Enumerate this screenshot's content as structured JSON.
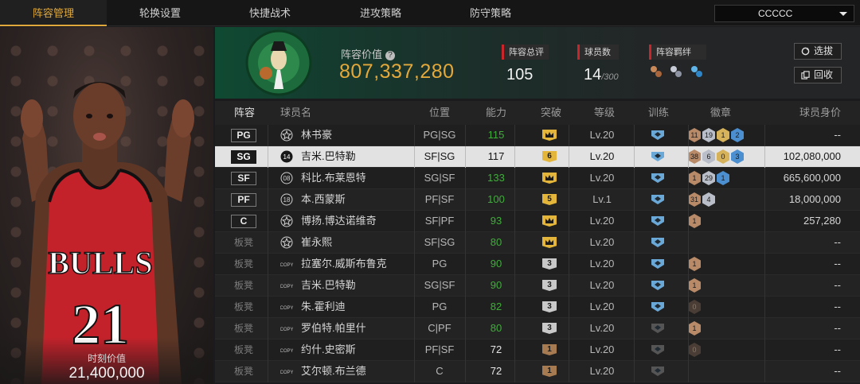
{
  "nav": {
    "tabs": [
      "阵容管理",
      "轮换设置",
      "快捷战术",
      "进攻策略",
      "防守策略"
    ],
    "active_tab": 0,
    "team_select": "CCCCC"
  },
  "featured_player": {
    "value_label": "时刻价值",
    "value": "21,400,000",
    "jersey": "21",
    "team_text": "BULLS"
  },
  "header": {
    "team_value_label": "阵容价值",
    "team_value": "807,337,280",
    "overall_label": "阵容总评",
    "overall_value": "105",
    "player_count_label": "球员数",
    "player_count": "14",
    "player_count_max": "/300",
    "bond_label": "阵容羁绊",
    "logo_text": "BOSTON CELTICS",
    "select_button": "选拔",
    "recycle_button": "回收"
  },
  "table": {
    "headers": {
      "lineup": "阵容",
      "name": "球员名",
      "position": "位置",
      "ability": "能力",
      "breakthrough": "突破",
      "level": "等级",
      "training": "训练",
      "badges": "徽章",
      "worth": "球员身价"
    },
    "rows": [
      {
        "slot": "PG",
        "rank": "star",
        "name": "林书豪",
        "pos": "PG|SG",
        "ability": "115",
        "ability_color": "green",
        "break": "crown",
        "break_color": "gold",
        "level": "Lv.20",
        "train": "blue",
        "badges": [
          {
            "v": "11",
            "c": "bronze"
          },
          {
            "v": "19",
            "c": "silver"
          },
          {
            "v": "1",
            "c": "gold"
          },
          {
            "v": "2",
            "c": "blue"
          }
        ],
        "worth": "--"
      },
      {
        "slot": "SG",
        "rank": "14",
        "name": "吉米.巴特勒",
        "pos": "SF|SG",
        "ability": "117",
        "ability_color": "white",
        "break": "6",
        "break_color": "gold",
        "level": "Lv.20",
        "train": "blue",
        "badges": [
          {
            "v": "38",
            "c": "bronze"
          },
          {
            "v": "6",
            "c": "silver"
          },
          {
            "v": "0",
            "c": "gold"
          },
          {
            "v": "3",
            "c": "blue"
          }
        ],
        "worth": "102,080,000",
        "selected": true
      },
      {
        "slot": "SF",
        "rank": "08",
        "name": "科比.布莱恩特",
        "pos": "SG|SF",
        "ability": "133",
        "ability_color": "green",
        "break": "crown",
        "break_color": "gold",
        "level": "Lv.20",
        "train": "blue",
        "badges": [
          {
            "v": "1",
            "c": "bronze"
          },
          {
            "v": "29",
            "c": "silver"
          },
          {
            "v": "1",
            "c": "blue"
          }
        ],
        "worth": "665,600,000"
      },
      {
        "slot": "PF",
        "rank": "18",
        "name": "本.西蒙斯",
        "pos": "PF|SF",
        "ability": "100",
        "ability_color": "green",
        "break": "5",
        "break_color": "gold",
        "level": "Lv.1",
        "train": "blue",
        "badges": [
          {
            "v": "31",
            "c": "bronze"
          },
          {
            "v": "4",
            "c": "silver"
          }
        ],
        "worth": "18,000,000"
      },
      {
        "slot": "C",
        "rank": "star",
        "name": "博扬.博达诺维奇",
        "pos": "SF|PF",
        "ability": "93",
        "ability_color": "green",
        "break": "crown",
        "break_color": "gold",
        "level": "Lv.20",
        "train": "blue",
        "badges": [
          {
            "v": "1",
            "c": "bronze"
          }
        ],
        "worth": "257,280"
      },
      {
        "slot": "板凳",
        "rank": "star",
        "name": "崔永熙",
        "pos": "SF|SG",
        "ability": "80",
        "ability_color": "green",
        "break": "crown",
        "break_color": "gold",
        "level": "Lv.20",
        "train": "blue",
        "badges": [],
        "worth": "--"
      },
      {
        "slot": "板凳",
        "rank": "COPY",
        "name": "拉塞尔.威斯布鲁克",
        "pos": "PG",
        "ability": "90",
        "ability_color": "green",
        "break": "3",
        "break_color": "grey",
        "level": "Lv.20",
        "train": "blue",
        "badges": [
          {
            "v": "1",
            "c": "bronze"
          }
        ],
        "worth": "--"
      },
      {
        "slot": "板凳",
        "rank": "COPY",
        "name": "吉米.巴特勒",
        "pos": "SG|SF",
        "ability": "90",
        "ability_color": "green",
        "break": "3",
        "break_color": "grey",
        "level": "Lv.20",
        "train": "blue",
        "badges": [
          {
            "v": "1",
            "c": "bronze"
          }
        ],
        "worth": "--"
      },
      {
        "slot": "板凳",
        "rank": "COPY",
        "name": "朱.霍利迪",
        "pos": "PG",
        "ability": "82",
        "ability_color": "green",
        "break": "3",
        "break_color": "grey",
        "level": "Lv.20",
        "train": "blue",
        "badges": [
          {
            "v": "0",
            "c": "dark"
          }
        ],
        "worth": "--"
      },
      {
        "slot": "板凳",
        "rank": "COPY",
        "name": "罗伯特.帕里什",
        "pos": "C|PF",
        "ability": "80",
        "ability_color": "green",
        "break": "3",
        "break_color": "grey",
        "level": "Lv.20",
        "train": "grey",
        "badges": [
          {
            "v": "1",
            "c": "bronze"
          }
        ],
        "worth": "--"
      },
      {
        "slot": "板凳",
        "rank": "COPY",
        "name": "约什.史密斯",
        "pos": "PF|SF",
        "ability": "72",
        "ability_color": "white",
        "break": "1",
        "break_color": "brown",
        "level": "Lv.20",
        "train": "grey",
        "badges": [
          {
            "v": "0",
            "c": "dark"
          }
        ],
        "worth": "--"
      },
      {
        "slot": "板凳",
        "rank": "COPY",
        "name": "艾尔顿.布兰德",
        "pos": "C",
        "ability": "72",
        "ability_color": "white",
        "break": "1",
        "break_color": "brown",
        "level": "Lv.20",
        "train": "grey",
        "badges": [],
        "worth": "--"
      }
    ]
  },
  "colors": {
    "accent_gold": "#e4a93a",
    "green_value": "#3fae3a",
    "stat_red": "#c8262b",
    "selected_row": "#e2e2e2"
  }
}
